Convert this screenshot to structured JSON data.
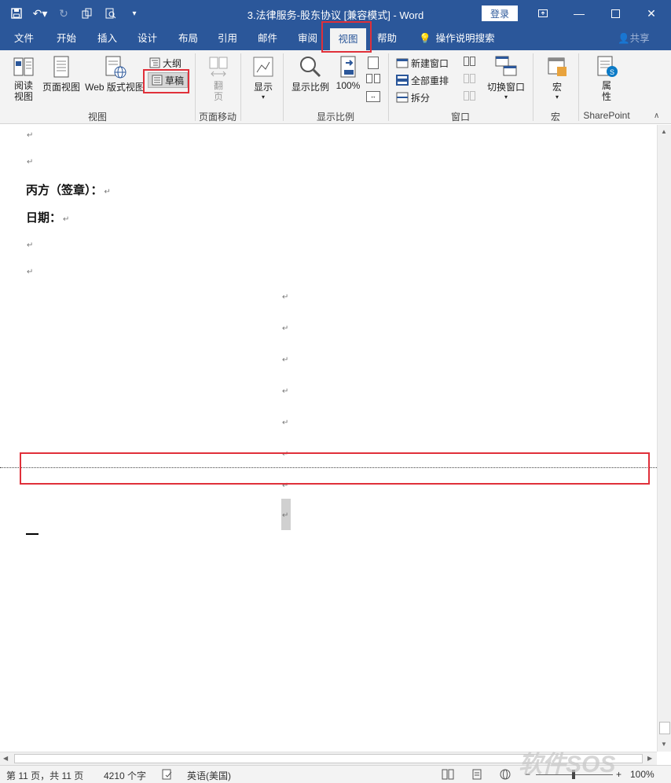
{
  "window": {
    "title": "3.法律服务-股东协议 [兼容模式]  -  Word",
    "login_label": "登录",
    "controls": [
      "restore-ribbon",
      "minimize",
      "maximize",
      "close"
    ]
  },
  "qat": {
    "icons": [
      "save-icon",
      "undo-icon",
      "redo-icon",
      "touch-mode-icon",
      "print-preview-icon",
      "customize-icon"
    ]
  },
  "tabs": {
    "file": "文件",
    "home": "开始",
    "insert": "插入",
    "design": "设计",
    "layout": "布局",
    "references": "引用",
    "mailings": "邮件",
    "review": "审阅",
    "view": "视图",
    "help": "帮助",
    "tell_me": "操作说明搜索",
    "share": "共享",
    "active": "视图"
  },
  "ribbon": {
    "views": {
      "read_mode": "阅读\n视图",
      "print_layout": "页面视图",
      "web_layout": "Web 版式视图",
      "outline": "大纲",
      "draft": "草稿",
      "group_label": "视图"
    },
    "page_movement": {
      "side_to_side": "翻\n页",
      "group_label": "页面移动"
    },
    "show": {
      "show_label": "显示"
    },
    "zoom": {
      "zoom_label": "显示比例",
      "hundred_label": "100%",
      "group_label": "显示比例"
    },
    "window": {
      "new_window": "新建窗口",
      "arrange_all": "全部重排",
      "split": "拆分",
      "switch_windows": "切换窗口",
      "group_label": "窗口"
    },
    "macros": {
      "macros_label": "宏",
      "group_label": "宏"
    },
    "sharepoint": {
      "properties_label": "属\n性",
      "group_label": "SharePoint"
    }
  },
  "document": {
    "para_mark": "↵",
    "party_c_sign": "丙方（签章）：",
    "date_label": "日期："
  },
  "statusbar": {
    "page_info": "第 11 页，共 11 页",
    "word_count": "4210 个字",
    "language": "英语(美国)",
    "zoom_level": "100%",
    "zoom_minus": "−",
    "zoom_plus": "+"
  },
  "watermark": {
    "text": "软件SOS"
  },
  "colors": {
    "brand": "#2b579a",
    "annotation": "#e0303a"
  }
}
